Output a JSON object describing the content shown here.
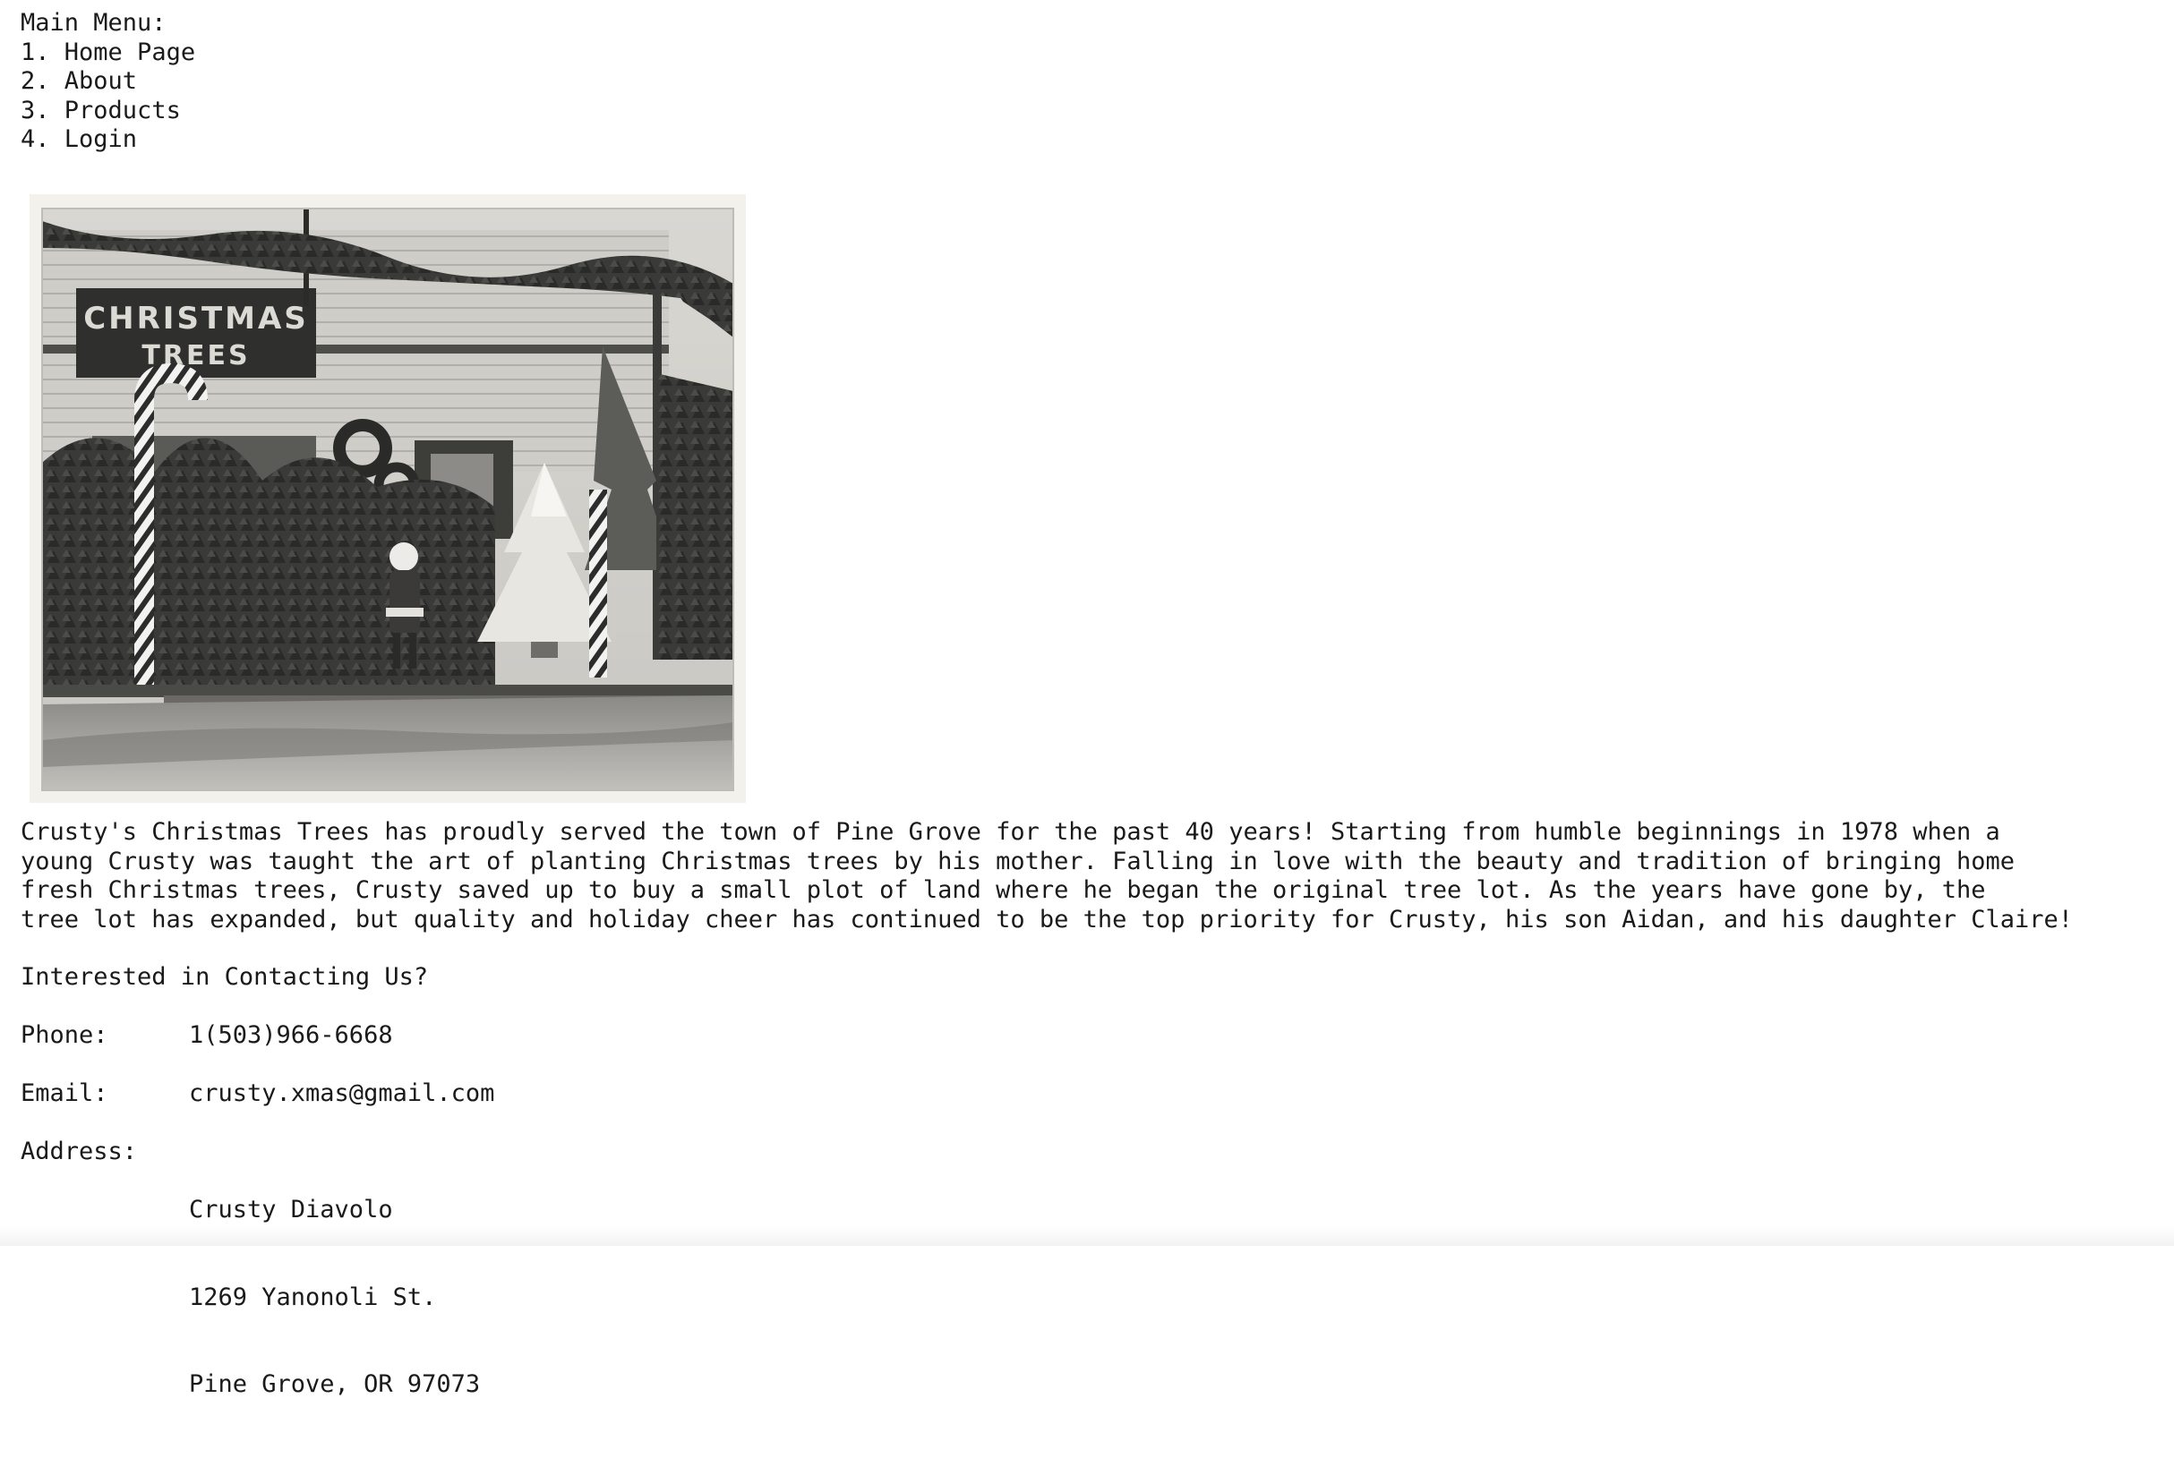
{
  "menu": {
    "title": "Main Menu:",
    "items": [
      {
        "number": "1.",
        "label": "Home Page"
      },
      {
        "number": "2.",
        "label": "About"
      },
      {
        "number": "3.",
        "label": "Products"
      },
      {
        "number": "4.",
        "label": "Login"
      }
    ]
  },
  "photo": {
    "sign_line1": "CHRISTMAS",
    "sign_line2": "TREES",
    "tone_dark": "#2a2a2a",
    "tone_light": "#e8e6e1"
  },
  "about": {
    "lines": [
      "Crusty's Christmas Trees has proudly served the town of Pine Grove for the past 40 years! Starting from humble beginnings in 1978 when a",
      "young Crusty was taught the art of planting Christmas trees by his mother. Falling in love with the beauty and tradition of bringing home",
      "fresh Christmas trees, Crusty saved up to buy a small plot of land where he began the original tree lot. As the years have gone by, the",
      "tree lot has expanded, but quality and holiday cheer has continued to be the top priority for Crusty, his son Aidan, and his daughter Claire!"
    ]
  },
  "contact": {
    "heading": "Interested in Contacting Us?",
    "phone_label": "Phone:",
    "phone": "1(503)966-6668",
    "email_label": "Email:",
    "email": "crusty.xmas@gmail.com",
    "address_label": "Address:",
    "address": [
      "Crusty Diavolo",
      "1269 Yanonoli St.",
      "Pine Grove, OR 97073"
    ]
  }
}
